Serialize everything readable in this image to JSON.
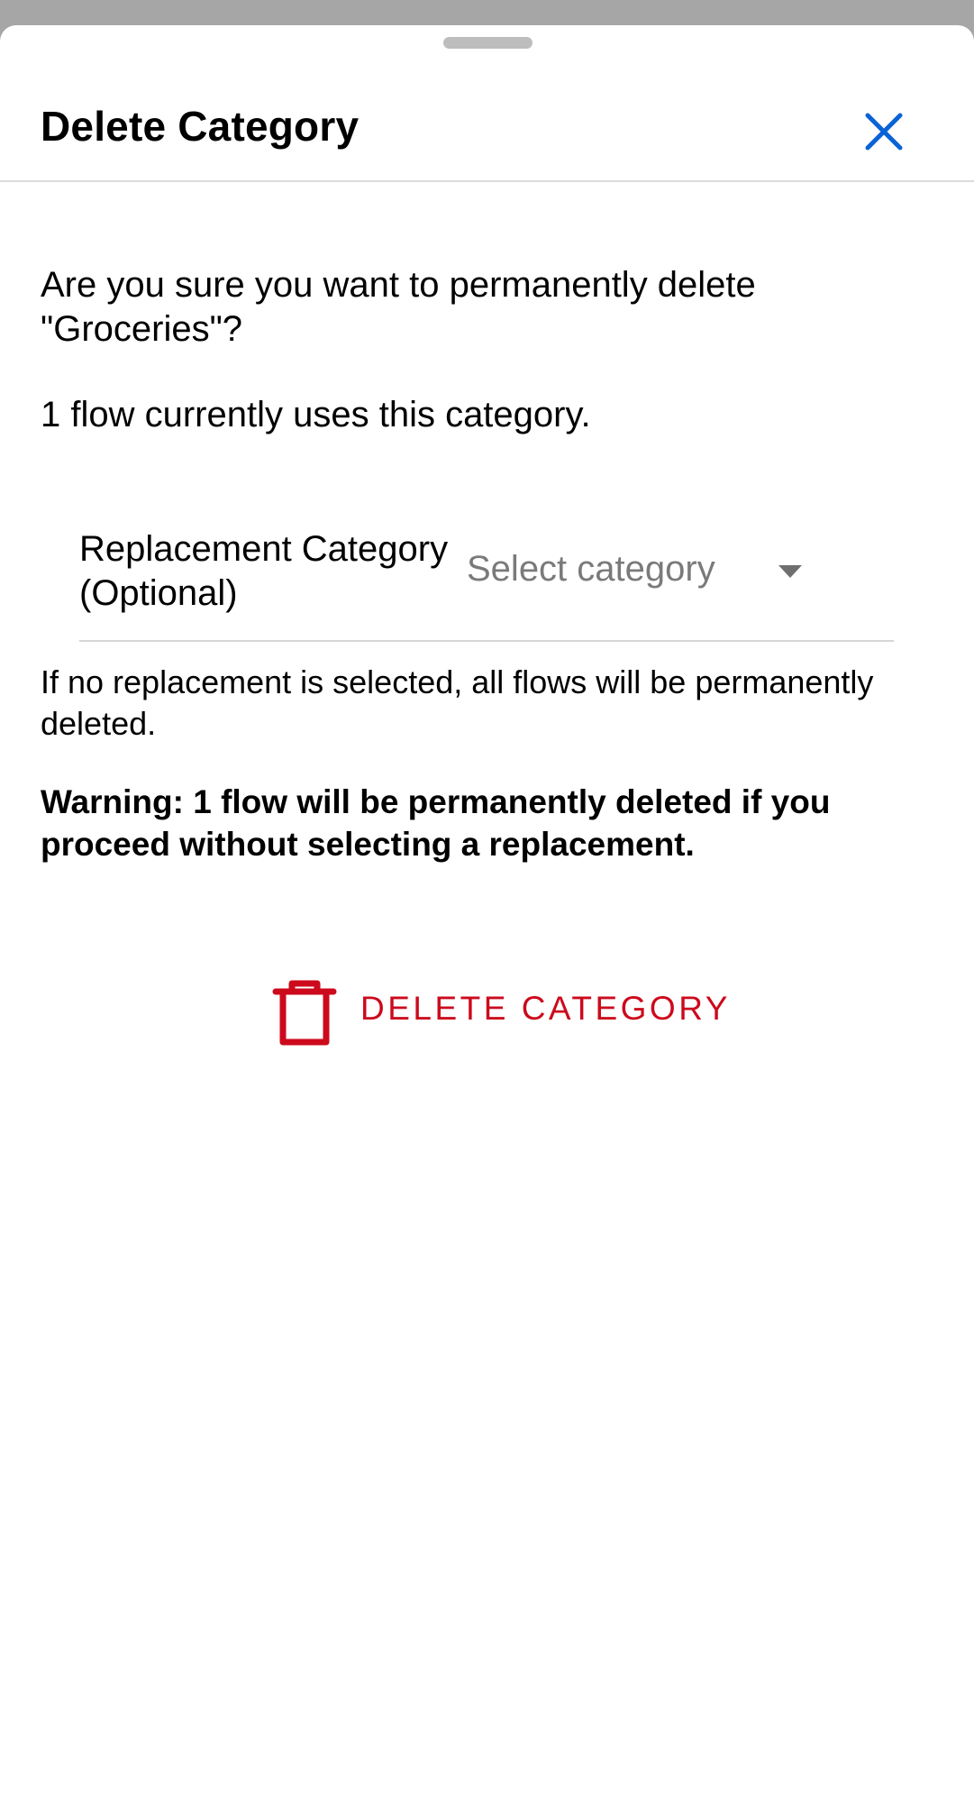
{
  "dialog": {
    "title": "Delete Category",
    "close_icon": "close-icon"
  },
  "content": {
    "confirm_message": "Are you sure you want to permanently delete \"Groceries\"?",
    "usage_message": "1 flow currently uses this category.",
    "replacement": {
      "label": "Replacement Category (Optional)",
      "placeholder": "Select category",
      "caret_icon": "caret-down-icon"
    },
    "note": "If no replacement is selected, all flows will be permanently deleted.",
    "warning": "Warning: 1 flow will be permanently deleted if you proceed without selecting a replacement."
  },
  "action": {
    "delete_label": "DELETE CATEGORY",
    "delete_icon": "trash-icon"
  },
  "colors": {
    "accent_blue": "#0a63d6",
    "danger_red": "#cc0a1c",
    "placeholder_gray": "#7a7a7a",
    "overlay_gray": "#a6a6a6"
  }
}
